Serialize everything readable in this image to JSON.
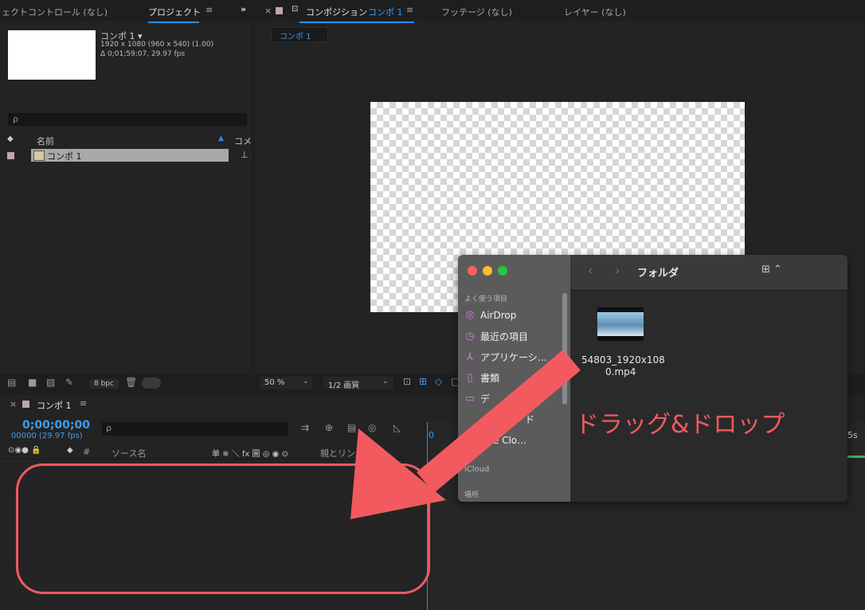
{
  "project_panel": {
    "tab_effects": "ェクトコントロール (なし)",
    "tab_project": "プロジェクト",
    "menu_icon": "≡",
    "expand": "»",
    "comp_name": "コンポ 1 ▾",
    "comp_res": "1920 x 1080  (960 x 540) (1.00)",
    "comp_dur": "Δ 0;01;59;07, 29.97 fps",
    "search_placeholder": "ρ",
    "col_name": "名前",
    "col_comment": "コメ",
    "item_label": "コンポ 1",
    "bpc": "8 bpc"
  },
  "comp_panel": {
    "close": "×",
    "lock_icon": "lock-icon",
    "tab_comp_prefix": "コンポジション",
    "tab_comp_name": "コンポ 1",
    "menu_icon": "≡",
    "tab_footage": "フッテージ (なし)",
    "tab_layer": "レイヤー (なし)",
    "sub_tab": "コンポ 1",
    "zoom": "50 %",
    "quality": "1/2 画質"
  },
  "timeline": {
    "close": "×",
    "tab_label": "コンポ 1",
    "menu_icon": "≡",
    "timecode": "0;00;00;00",
    "frames": "00000 (29.97 fps)",
    "search_placeholder": "ρ",
    "col_num": "#",
    "col_source": "ソース名",
    "col_switches": "单 ※ ＼ fx 圖 ◎ ◉ ⊙",
    "col_parent": "親とリンク",
    "ruler_partial": "0",
    "ruler_end": "5s"
  },
  "finder": {
    "section_favorites": "よく使う項目",
    "items": [
      {
        "icon": "airdrop-icon",
        "glyph": "◎",
        "label": "AirDrop"
      },
      {
        "icon": "recent-icon",
        "glyph": "◷",
        "label": "最近の項目"
      },
      {
        "icon": "applications-icon",
        "glyph": "⅄",
        "label": "アプリケーシ…"
      },
      {
        "icon": "documents-icon",
        "glyph": "▯",
        "label": "書類"
      },
      {
        "icon": "desktop-icon",
        "glyph": "▭",
        "label": "デ"
      },
      {
        "icon": "download-icon",
        "glyph": "⇣",
        "label": "ド"
      },
      {
        "icon": "creative-cloud-icon",
        "glyph": "☁",
        "label": "eative Clo…"
      }
    ],
    "section_icloud": "iCloud",
    "section_places": "場所",
    "folder_title": "フォルダ",
    "file_name_line1": "54803_1920x108",
    "file_name_line2": "0.mp4",
    "view_icon": "grid-view-icon"
  },
  "annotation": {
    "drag_text": "ドラッグ&ドロップ",
    "color": "#f25a5f"
  }
}
